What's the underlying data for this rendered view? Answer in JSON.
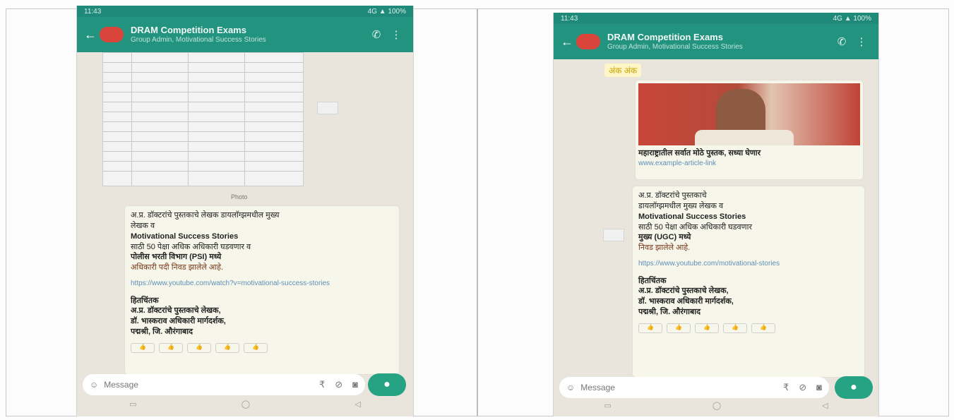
{
  "left_phone": {
    "status": {
      "time": "11:43",
      "right": "4G ▲ 100%"
    },
    "appbar": {
      "title": "DRAM Competition Exams",
      "subtitle": "Group Admin, Motivational Success Stories"
    },
    "table_caption": "Photo",
    "message": {
      "line1": "अ.प्र. डॉक्टरांचे पुस्तकाचे लेखक डायलाॅग्झमधील मुख्य",
      "line2": "लेखक व",
      "bold1": "Motivational Success Stories",
      "line3": "साठी 50 पेक्षा अधिक अधिकारी घडवणार व",
      "bold2": "पोलीस भरती विभाग (PSI) मध्ये",
      "line4": "अधिकारी पदी निवड झालेले आहे.",
      "link": "https://www.youtube.com/watch?v=motivational-success-stories",
      "sig_head": "हितचिंतक",
      "sig1": "अ.प्र. डॉक्टरांचे पुस्तकाचे लेखक,",
      "sig2": "डॉ. भास्कराव अधिकारी मार्गदर्शक,",
      "sig3": "पद्मश्री, जि. औरंगाबाद"
    },
    "reactions": [
      "👍",
      "👍",
      "👍",
      "👍",
      "👍"
    ],
    "input": {
      "placeholder": "Message"
    },
    "send_icon": "mic",
    "nav": [
      "▭",
      "◯",
      "◁"
    ]
  },
  "right_phone": {
    "status": {
      "time": "11:43",
      "right": "4G ▲ 100%"
    },
    "appbar": {
      "title": "DRAM Competition Exams",
      "subtitle": "Group Admin, Motivational Success Stories"
    },
    "top_tag": "अंक अंक",
    "photo_caption": "महाराष्ट्रातील सर्वात मोठे पुस्तक, सध्या घेणार",
    "photo_link": "www.example-article-link",
    "message": {
      "line1": "अ.प्र. डॉक्टरांचे पुस्तकाचे",
      "line2": "डायलाॅग्झमधील मुख्य लेखक व",
      "bold1": "Motivational Success Stories",
      "line3": "साठी 50 पेक्षा अधिक अधिकारी घडवणार",
      "bold2": "मुख्य (UGC) मध्ये",
      "line4": "निवड झालेले आहे.",
      "link": "https://www.youtube.com/motivational-stories",
      "sig_head": "हितचिंतक",
      "sig1": "अ.प्र. डॉक्टरांचे पुस्तकाचे लेखक,",
      "sig2": "डॉ. भास्कराव अधिकारी मार्गदर्शक,",
      "sig3": "पद्मश्री, जि. औरंगाबाद"
    },
    "reactions": [
      "👍",
      "👍",
      "👍",
      "👍",
      "👍"
    ],
    "input": {
      "placeholder": "Message"
    },
    "send_icon": "mic",
    "nav": [
      "▭",
      "◯",
      "◁"
    ]
  }
}
